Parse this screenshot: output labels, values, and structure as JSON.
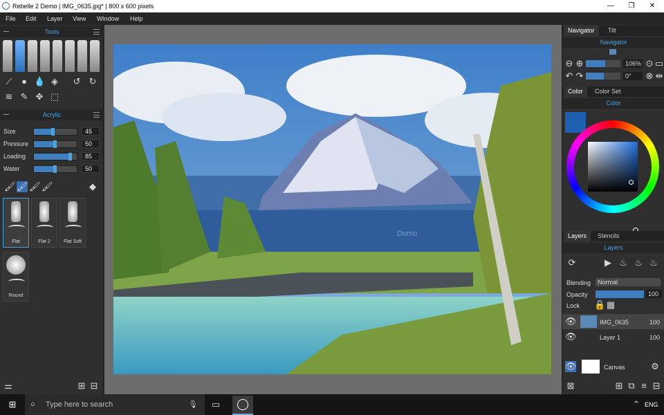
{
  "window": {
    "title": "Rebelle 2 Demo | IMG_0635.jpg* | 800 x 600 pixels",
    "controls": [
      "—",
      "❐",
      "✕"
    ]
  },
  "menu": [
    "File",
    "Edit",
    "Layer",
    "View",
    "Window",
    "Help"
  ],
  "tools_panel": {
    "title": "Tools"
  },
  "acrylic_panel": {
    "title": "Acrylic",
    "params": [
      {
        "label": "Size",
        "value": "45",
        "level": 0.45
      },
      {
        "label": "Pressure",
        "value": "50",
        "level": 0.5
      },
      {
        "label": "Loading",
        "value": "85",
        "level": 0.85
      },
      {
        "label": "Water",
        "value": "50",
        "level": 0.5
      }
    ]
  },
  "brushes": [
    {
      "label": "Flat",
      "selected": true
    },
    {
      "label": "Flat 2",
      "selected": false
    },
    {
      "label": "Flat Soft",
      "selected": false
    },
    {
      "label": "Round",
      "selected": false
    }
  ],
  "navigator": {
    "tabs": [
      "Navigator",
      "Tilt"
    ],
    "title": "Navigator",
    "zoom": "106%",
    "rotation": "0°"
  },
  "color": {
    "tabs": [
      "Color",
      "Color Set"
    ],
    "title": "Color",
    "current": "#1f5fb0"
  },
  "layers": {
    "tabs": [
      "Layers",
      "Stencils"
    ],
    "title": "Layers",
    "blending_label": "Blending",
    "blending_value": "Normal",
    "opacity_label": "Opacity",
    "opacity_value": "100",
    "lock_label": "Lock",
    "items": [
      {
        "name": "IMG_0635",
        "opacity": "100"
      },
      {
        "name": "Layer 1",
        "opacity": "100"
      }
    ],
    "canvas_label": "Canvas"
  },
  "watermark": "Demo",
  "taskbar": {
    "search_placeholder": "Type here to search",
    "lang": "ENG"
  }
}
